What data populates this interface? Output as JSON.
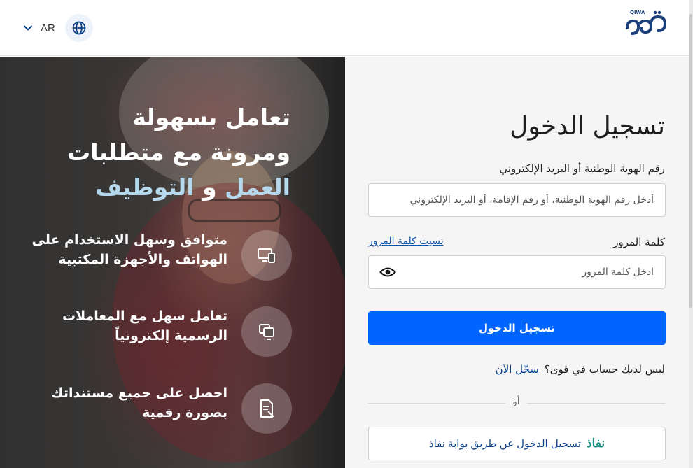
{
  "header": {
    "language_label": "AR",
    "logo_text": "QIWA"
  },
  "hero": {
    "title_line1": "تعامل بسهولة",
    "title_line2": "ومرونة مع متطلبات",
    "title_accent1": "العمل",
    "title_join": " و ",
    "title_accent2": "التوظيف",
    "features": [
      {
        "icon": "devices-icon",
        "text": "متوافق وسهل الاستخدام على الهواتف والأجهزة المكتبية"
      },
      {
        "icon": "transactions-icon",
        "text": "تعامل سهل مع المعاملات الرسمية إلكترونياً"
      },
      {
        "icon": "documents-icon",
        "text": "احصل على جميع مستنداتك بصورة رقمية"
      }
    ]
  },
  "login": {
    "title": "تسجيل الدخول",
    "id_label": "رقم الهوية الوطنية أو البريد الإلكتروني",
    "id_placeholder": "أدخل رقم الهوية الوطنية، أو رقم الإقامة، أو البريد الإلكتروني",
    "id_value": "",
    "password_label": "كلمة المرور",
    "forgot_password": "نسيت كلمة المرور",
    "password_placeholder": "أدخل كلمة المرور",
    "password_value": "",
    "submit_label": "تسجيل الدخول",
    "no_account_text": "ليس لديك حساب في قوى؟",
    "register_link": "سجّل الآن",
    "or_text": "أو",
    "nafath_logo": "نفاذ",
    "nafath_label": "تسجيل الدخول عن طريق بوابة نفاذ"
  },
  "colors": {
    "primary": "#0064ff",
    "link": "#0b3f8a",
    "accent_light_blue": "#b6d8ec",
    "nafath_green": "#1a8f7d",
    "panel_bg": "#f5f5f5"
  }
}
